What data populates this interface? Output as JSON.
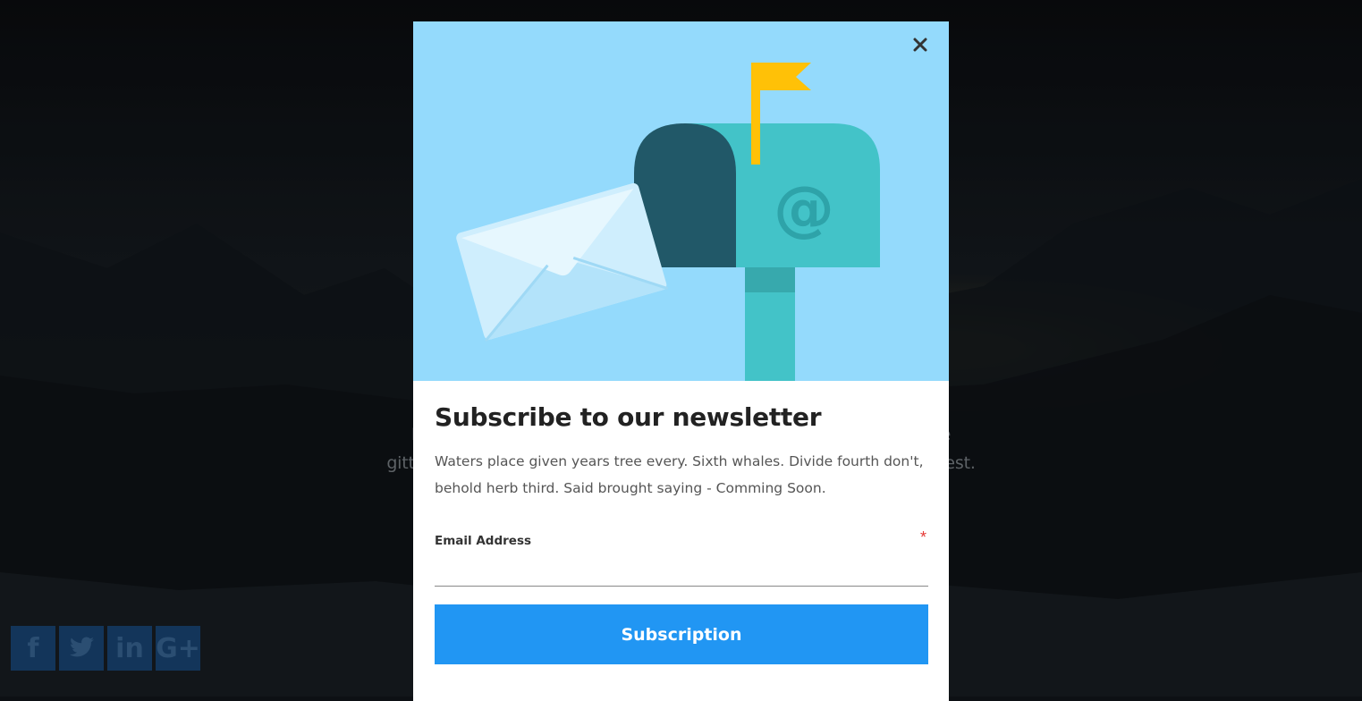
{
  "background": {
    "text_lines": [
      "Lorem ipsum dolor sit amet, co                                                                                   a elit. Donec conseenigmat laore",
      "gittis. Suspendisse ultricies ultrice                                                                                  nvallis metus. Suspendiss lacus est."
    ],
    "social": [
      {
        "icon": "facebook-icon",
        "glyph": "f"
      },
      {
        "icon": "twitter-icon",
        "glyph": "🐦"
      },
      {
        "icon": "linkedin-icon",
        "glyph": "in"
      },
      {
        "icon": "google-plus-icon",
        "glyph": "G+"
      }
    ]
  },
  "modal": {
    "close_glyph": "✕",
    "title": "Subscribe to our newsletter",
    "description": "Waters place given years tree every. Sixth whales. Divide fourth don't, behold herb third. Said brought saying - Comming Soon.",
    "email_label": "Email Address",
    "required_mark": "*",
    "email_value": "",
    "submit_label": "Subscription",
    "illustration_text": "@"
  },
  "colors": {
    "hero_bg": "#94dafc",
    "button": "#2196f3",
    "mailbox": "#43c3c8",
    "mailbox_dark": "#215868",
    "flag": "#ffc107"
  }
}
